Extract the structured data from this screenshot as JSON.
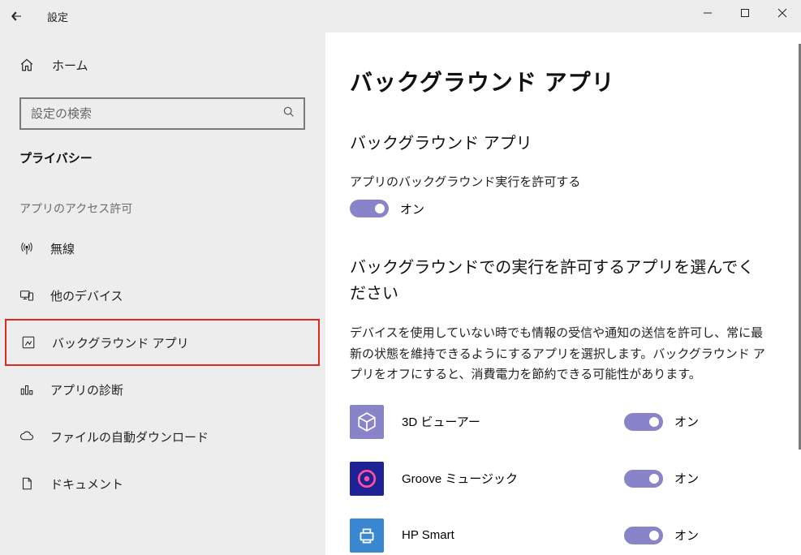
{
  "window": {
    "title": "設定"
  },
  "sidebar": {
    "home": "ホーム",
    "search_placeholder": "設定の検索",
    "category": "プライバシー",
    "section": "アプリのアクセス許可",
    "items": [
      {
        "label": "無線"
      },
      {
        "label": "他のデバイス"
      },
      {
        "label": "バックグラウンド アプリ"
      },
      {
        "label": "アプリの診断"
      },
      {
        "label": "ファイルの自動ダウンロード"
      },
      {
        "label": "ドキュメント"
      }
    ]
  },
  "content": {
    "page_title": "バックグラウンド アプリ",
    "subheading": "バックグラウンド アプリ",
    "allow_label": "アプリのバックグラウンド実行を許可する",
    "master_state": "オン",
    "choose_heading": "バックグラウンドでの実行を許可するアプリを選んでください",
    "description": "デバイスを使用していない時でも情報の受信や通知の送信を許可し、常に最新の状態を維持できるようにするアプリを選択します。バックグラウンド アプリをオフにすると、消費電力を節約できる可能性があります。",
    "apps": [
      {
        "name": "3D ビューアー",
        "state": "オン"
      },
      {
        "name": "Groove ミュージック",
        "state": "オン"
      },
      {
        "name": "HP Smart",
        "state": "オン"
      }
    ]
  }
}
